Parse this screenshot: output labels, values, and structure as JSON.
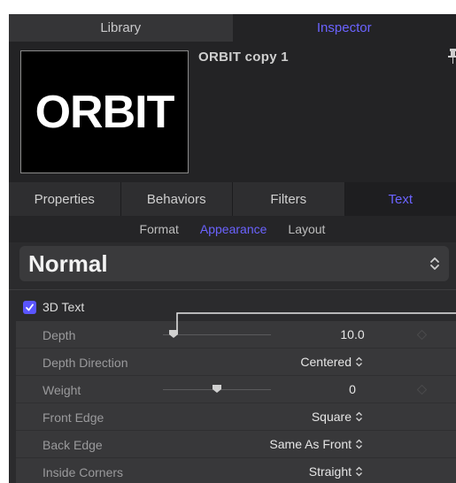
{
  "top_tabs": {
    "library": "Library",
    "inspector": "Inspector"
  },
  "preview": {
    "thumbnail_text": "ORBIT",
    "object_name": "ORBIT copy 1"
  },
  "section_tabs": [
    "Properties",
    "Behaviors",
    "Filters",
    "Text"
  ],
  "active_section_tab": "Text",
  "subtabs": [
    "Format",
    "Appearance",
    "Layout"
  ],
  "active_subtab": "Appearance",
  "preset": {
    "label": "Normal"
  },
  "group": {
    "label": "3D Text",
    "checked": true
  },
  "rows": {
    "depth": {
      "label": "Depth",
      "value": "10.0",
      "slider_fraction": 0.1
    },
    "depth_direction": {
      "label": "Depth Direction",
      "value": "Centered"
    },
    "weight": {
      "label": "Weight",
      "value": "0",
      "slider_fraction": 0.5
    },
    "front_edge": {
      "label": "Front Edge",
      "value": "Square"
    },
    "back_edge": {
      "label": "Back Edge",
      "value": "Same As Front"
    },
    "inside_corners": {
      "label": "Inside Corners",
      "value": "Straight"
    }
  },
  "colors": {
    "accent": "#6b63ff",
    "panel": "#2b2b2d",
    "row": "#38383a",
    "checkbox": "#5a55ff"
  }
}
